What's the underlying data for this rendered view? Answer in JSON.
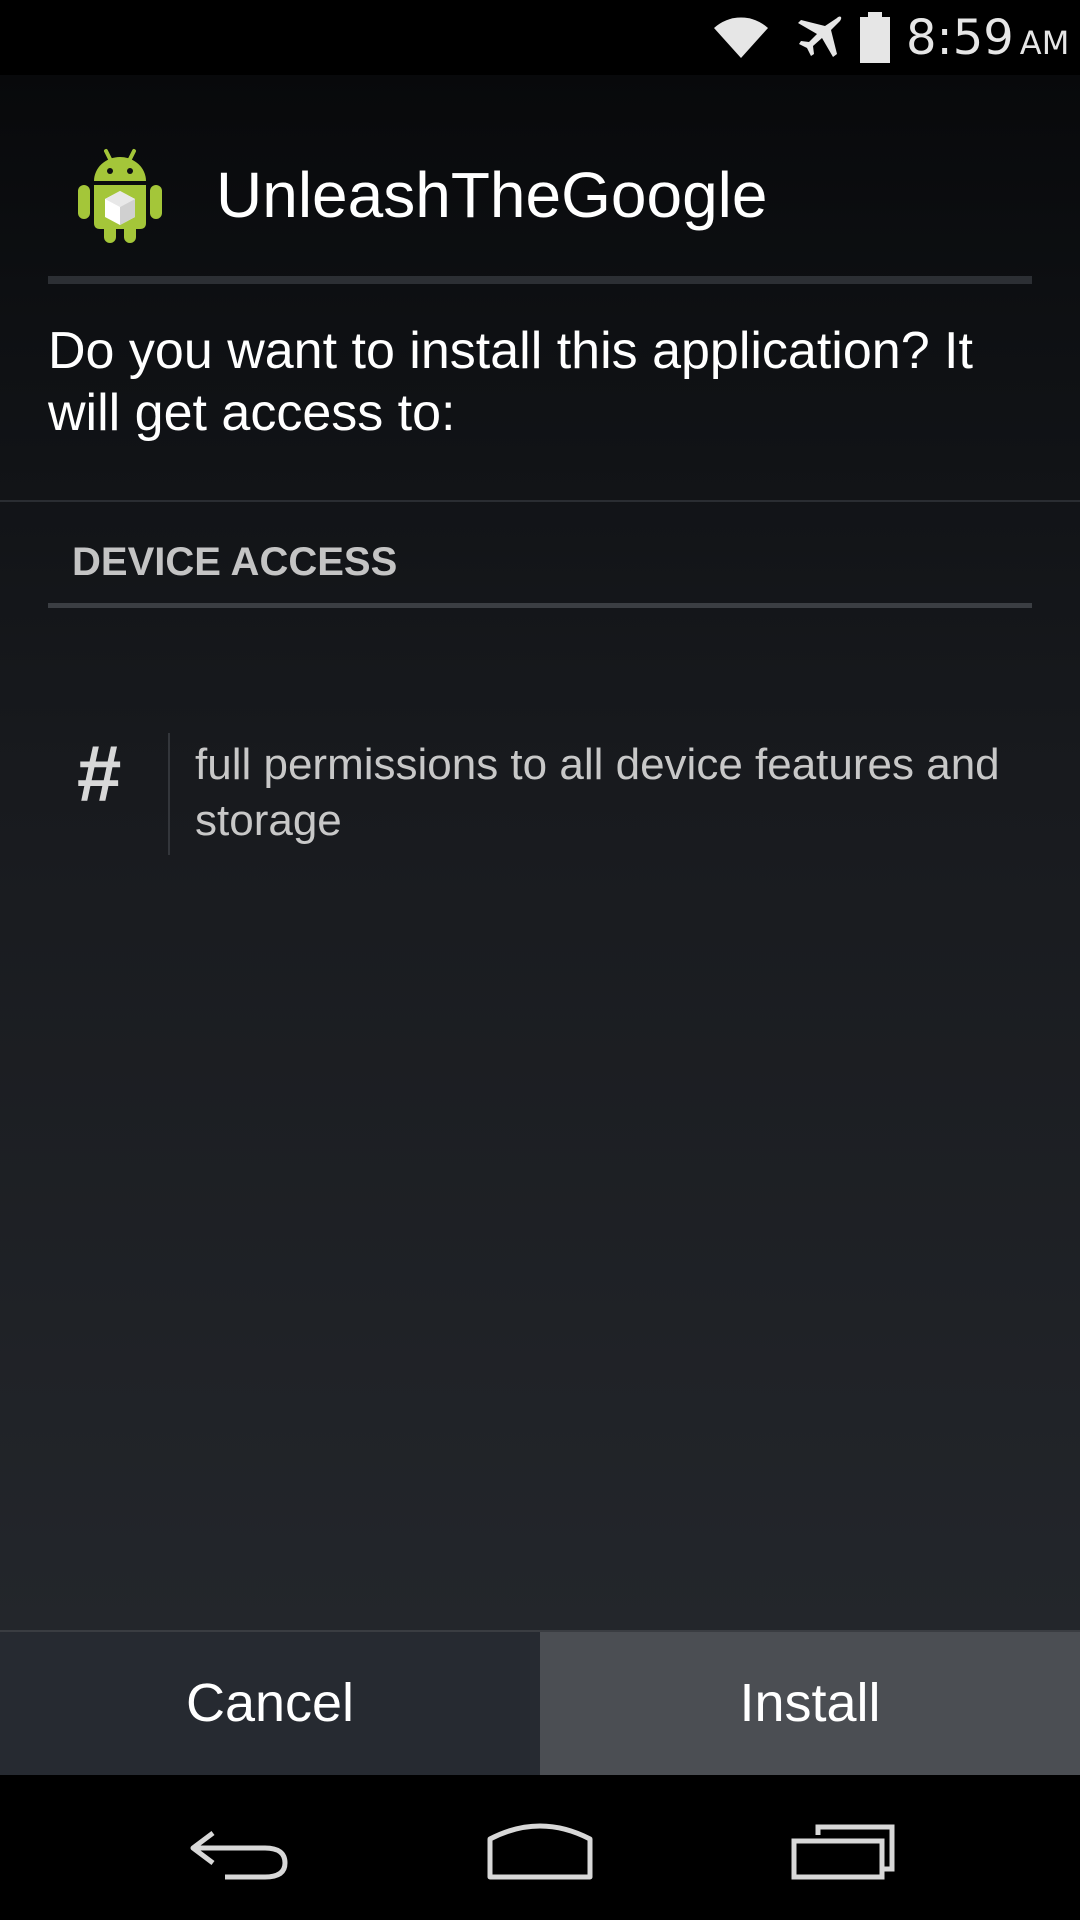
{
  "status_bar": {
    "time": "8:59",
    "ampm": "AM",
    "icons": [
      "wifi-icon",
      "airplane-mode-icon",
      "battery-icon"
    ]
  },
  "dialog": {
    "app_name": "UnleashTheGoogle",
    "app_icon": "android-package-icon",
    "prompt": "Do you want to install this application? It will get access to:",
    "section_heading": "DEVICE ACCESS",
    "permissions": [
      {
        "icon": "hash-icon",
        "icon_glyph": "#",
        "text": "full permissions to all device features and storage"
      }
    ]
  },
  "buttons": {
    "cancel_label": "Cancel",
    "install_label": "Install"
  },
  "nav_bar": {
    "icons": [
      "back-icon",
      "home-icon",
      "recents-icon"
    ]
  },
  "colors": {
    "android_green": "#a4c639",
    "install_button_bg": "#4b4e53",
    "cancel_button_bg": "#262a31"
  }
}
